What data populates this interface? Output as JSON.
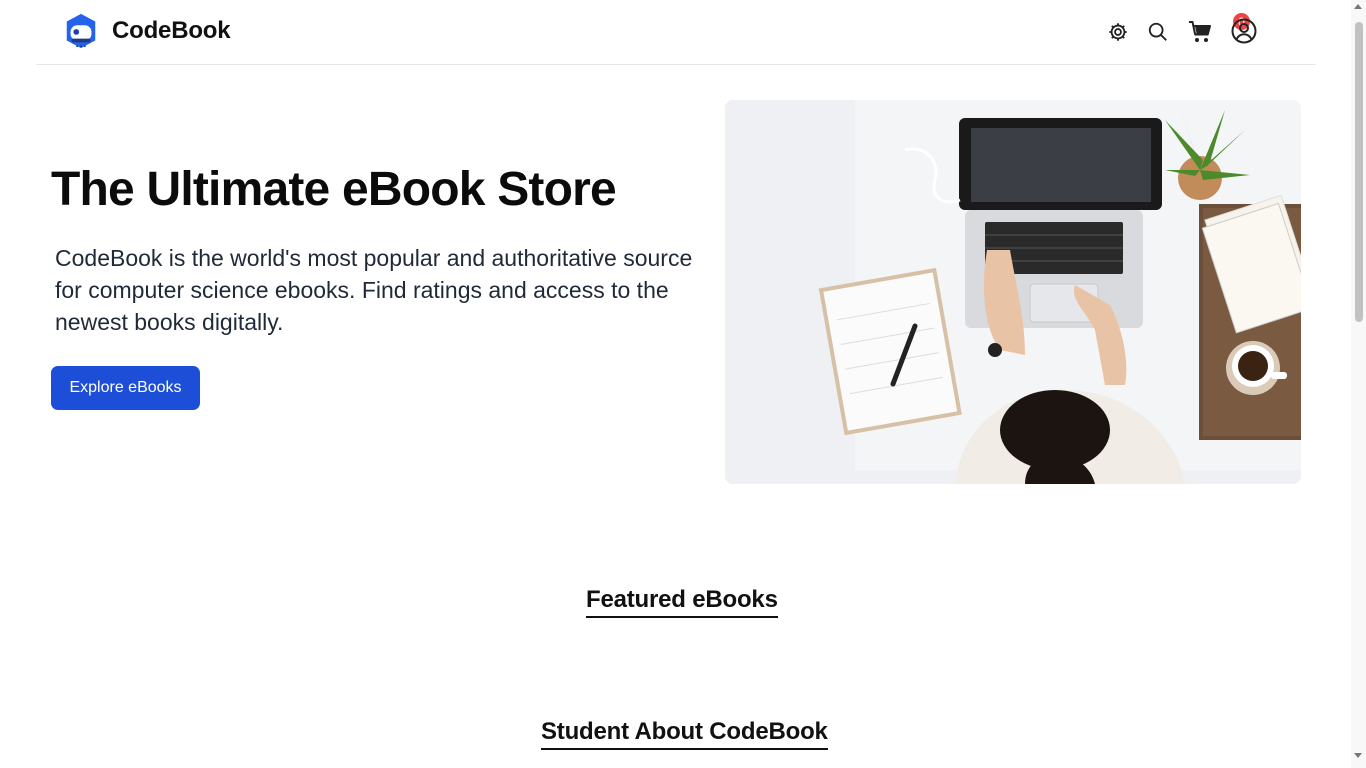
{
  "header": {
    "brand_name": "CodeBook",
    "logo_icon": "robot-logo-icon",
    "icons": [
      "gear-icon",
      "search-icon",
      "cart-icon",
      "user-icon"
    ],
    "cart_count": "0"
  },
  "hero": {
    "title": "The Ultimate eBook Store",
    "description": "CodeBook is the world's most popular and authoritative source for computer science ebooks. Find ratings and access to the newest books digitally.",
    "cta_label": "Explore eBooks",
    "image": "workspace-photo"
  },
  "sections": {
    "featured_title": "Featured eBooks",
    "students_title": "Student About CodeBook"
  },
  "colors": {
    "primary": "#1d4ed8",
    "badge": "#ef4444",
    "text": "#111111"
  }
}
